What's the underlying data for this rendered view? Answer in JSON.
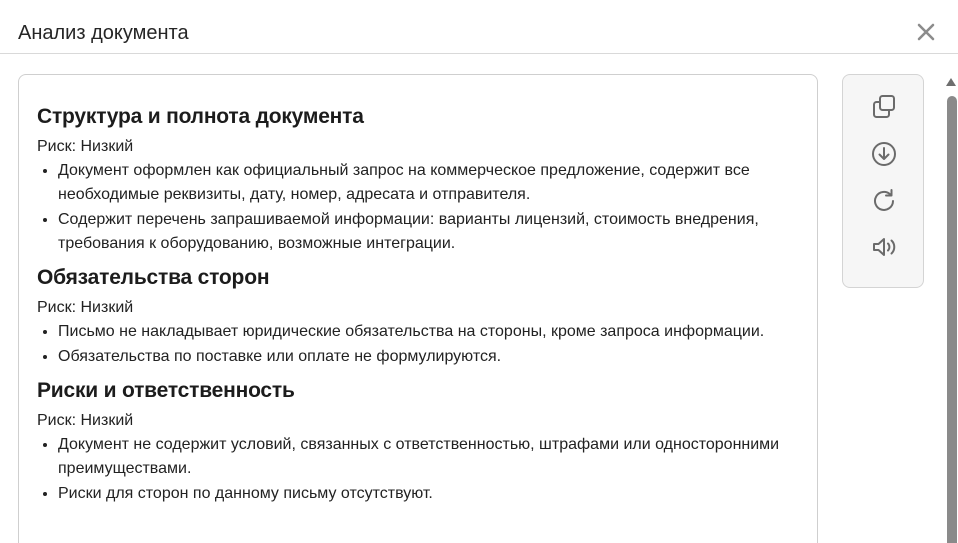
{
  "dialog": {
    "title": "Анализ документа",
    "close_icon": "close-icon"
  },
  "sections": [
    {
      "heading": "Структура и полнота документа",
      "risk": "Риск: Низкий",
      "bullets": [
        "Документ оформлен как официальный запрос на коммерческое предложение, содержит все необходимые реквизиты, дату, номер, адресата и отправителя.",
        "Содержит перечень запрашиваемой информации: варианты лицензий, стоимость внедрения, требования к оборудованию, возможные интеграции."
      ]
    },
    {
      "heading": "Обязательства сторон",
      "risk": "Риск: Низкий",
      "bullets": [
        "Письмо не накладывает юридические обязательства на стороны, кроме запроса информации.",
        "Обязательства по поставке или оплате не формулируются."
      ]
    },
    {
      "heading": "Риски и ответственность",
      "risk": "Риск: Низкий",
      "bullets": [
        "Документ не содержит условий, связанных с ответственностью, штрафами или односторонними преимуществами.",
        "Риски для сторон по данному письму отсутствуют."
      ]
    }
  ],
  "toolbar": {
    "icons": [
      "copy-icon",
      "download-icon",
      "refresh-icon",
      "speaker-icon"
    ]
  },
  "colors": {
    "icon": "#6b6b6b",
    "toolbar_bg": "#f6f6f6",
    "border": "#cfcfcf",
    "scroll_thumb": "#8a8a8a"
  }
}
